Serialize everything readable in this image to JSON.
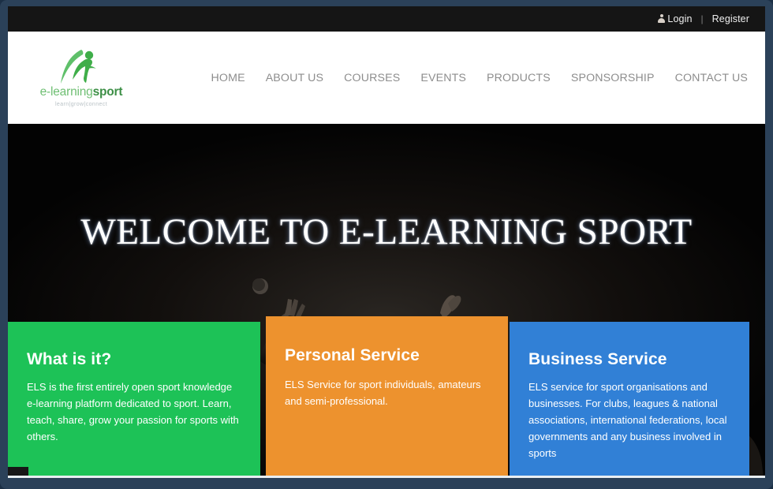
{
  "site": {
    "brand_name": "e-learning sport",
    "brand_name_part1": "e-learning",
    "brand_name_part2": "sport",
    "tagline": "learn|grow|connect"
  },
  "topbar": {
    "login_label": "Login",
    "separator": "|",
    "register_label": "Register",
    "login_icon": "user-icon"
  },
  "nav": {
    "items": [
      {
        "label": "HOME"
      },
      {
        "label": "ABOUT US"
      },
      {
        "label": "COURSES"
      },
      {
        "label": "EVENTS"
      },
      {
        "label": "PRODUCTS"
      },
      {
        "label": "SPONSORSHIP"
      },
      {
        "label": "CONTACT US"
      }
    ]
  },
  "hero": {
    "title": "WELCOME TO E-LEARNING SPORT",
    "background": "dark sport photo of players reaching for a ball"
  },
  "panels": [
    {
      "key": "what-is-it",
      "title": "What is it?",
      "body": "ELS is the first entirely open sport knowledge e-learning platform dedicated to sport. Learn, teach, share, grow your passion for sports with others.",
      "color": "#1dc257"
    },
    {
      "key": "personal-service",
      "title": "Personal Service",
      "body": "ELS Service for sport individuals, amateurs and semi-professional.",
      "color": "#ed922e"
    },
    {
      "key": "business-service",
      "title": "Business Service",
      "body": "ELS service for sport organisations and businesses. For clubs, leagues & national associations, international federations, local governments and any business involved in sports",
      "color": "#3180d6"
    }
  ],
  "colors": {
    "frame": "#2b4159",
    "topbar": "#151515",
    "header": "#ffffff",
    "nav_text": "#8d8d8d",
    "hero_bg": "#060606",
    "green": "#1dc257",
    "orange": "#ed922e",
    "blue": "#3180d6"
  }
}
